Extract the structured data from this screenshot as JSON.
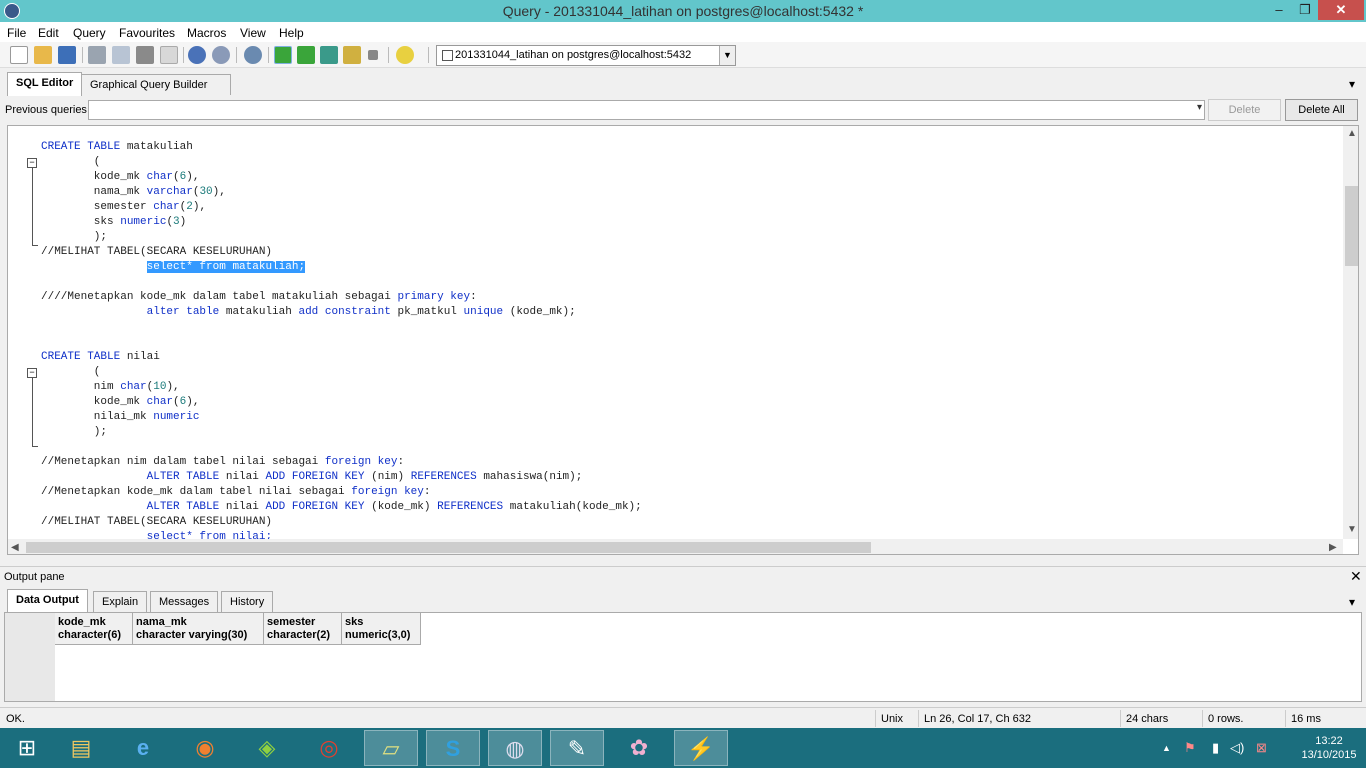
{
  "window": {
    "title": "Query - 201331044_latihan on postgres@localhost:5432 *",
    "min_glyph": "‒",
    "max_glyph": "❐",
    "close_glyph": "✕"
  },
  "menu": [
    "File",
    "Edit",
    "Query",
    "Favourites",
    "Macros",
    "View",
    "Help"
  ],
  "toolbar": {
    "icons": [
      "new-file-icon",
      "open-folder-icon",
      "save-icon",
      "cut-icon",
      "copy-icon",
      "paste-icon",
      "clear-icon",
      "undo-icon",
      "redo-icon",
      "find-icon",
      "execute-icon",
      "execute-pgscript-icon",
      "execute-to-file-icon",
      "explain-icon",
      "cancel-icon",
      "help-icon"
    ],
    "connection": "201331044_latihan on postgres@localhost:5432",
    "dropdown_glyph": "▼"
  },
  "editor_tabs": [
    "SQL Editor",
    "Graphical Query Builder"
  ],
  "panel_menu_glyph": "▾",
  "previous_queries": {
    "label": "Previous queries",
    "value": "",
    "delete": "Delete",
    "delete_all": "Delete All",
    "dropdown_glyph": "▾"
  },
  "scroll": {
    "up": "▲",
    "down": "▼",
    "left": "◀",
    "right": "▶"
  },
  "fold_glyph": "−",
  "code": {
    "l1a": "CREATE TABLE",
    "l1b": " matakuliah",
    "l2": "        (",
    "l3a": "        kode_mk ",
    "l3b": "char",
    "l3c": "(",
    "l3d": "6",
    "l3e": "),",
    "l4a": "        nama_mk ",
    "l4b": "varchar",
    "l4c": "(",
    "l4d": "30",
    "l4e": "),",
    "l5a": "        semester ",
    "l5b": "char",
    "l5c": "(",
    "l5d": "2",
    "l5e": "),",
    "l6a": "        sks ",
    "l6b": "numeric",
    "l6c": "(",
    "l6d": "3",
    "l6e": ")",
    "l7": "        );",
    "l8": "//MELIHAT TABEL(SECARA KESELURUHAN)",
    "l9a": "                ",
    "l9b": "select* from matakuliah;",
    "l10": "",
    "l11a": "////Menetapkan kode_mk dalam tabel matakuliah sebagai ",
    "l11b": "primary key",
    "l11c": ":",
    "l12a": "                ",
    "l12b": "alter table",
    "l12c": " matakuliah ",
    "l12d": "add constraint",
    "l12e": " pk_matkul ",
    "l12f": "unique",
    "l12g": " (kode_mk);",
    "l13": "",
    "l14": "",
    "l15a": "CREATE TABLE",
    "l15b": " nilai",
    "l16": "        (",
    "l17a": "        nim ",
    "l17b": "char",
    "l17c": "(",
    "l17d": "10",
    "l17e": "),",
    "l18a": "        kode_mk ",
    "l18b": "char",
    "l18c": "(",
    "l18d": "6",
    "l18e": "),",
    "l19a": "        nilai_mk ",
    "l19b": "numeric",
    "l20": "        );",
    "l21": "",
    "l22a": "//Menetapkan nim dalam tabel nilai sebagai ",
    "l22b": "foreign key",
    "l22c": ":",
    "l23a": "                ",
    "l23b": "ALTER TABLE",
    "l23c": " nilai ",
    "l23d": "ADD FOREIGN KEY",
    "l23e": " (nim) ",
    "l23f": "REFERENCES",
    "l23g": " mahasiswa(nim);",
    "l24a": "//Menetapkan kode_mk dalam tabel nilai sebagai ",
    "l24b": "foreign key",
    "l24c": ":",
    "l25a": "                ",
    "l25b": "ALTER TABLE",
    "l25c": " nilai ",
    "l25d": "ADD FOREIGN KEY",
    "l25e": " (kode_mk) ",
    "l25f": "REFERENCES",
    "l25g": " matakuliah(kode_mk);",
    "l26": "//MELIHAT TABEL(SECARA KESELURUHAN)",
    "l27a": "                ",
    "l27b": "select* from nilai;"
  },
  "output": {
    "label": "Output pane",
    "close_glyph": "✕",
    "tabs": [
      "Data Output",
      "Explain",
      "Messages",
      "History"
    ],
    "columns": [
      {
        "name": "kode_mk",
        "type": "character(6)"
      },
      {
        "name": "nama_mk",
        "type": "character varying(30)"
      },
      {
        "name": "semester",
        "type": "character(2)"
      },
      {
        "name": "sks",
        "type": "numeric(3,0)"
      }
    ]
  },
  "status": {
    "msg": "OK.",
    "eol": "Unix",
    "pos": "Ln 26, Col 17, Ch 632",
    "chars": "24 chars",
    "rows": "0 rows.",
    "time": "16 ms"
  },
  "taskbar": {
    "apps": [
      {
        "name": "start-button",
        "glyph": "⊞"
      },
      {
        "name": "file-explorer-icon",
        "glyph": "▤"
      },
      {
        "name": "internet-explorer-icon",
        "glyph": "e"
      },
      {
        "name": "firefox-icon",
        "glyph": "◉"
      },
      {
        "name": "bluestacks-icon",
        "glyph": "◈"
      },
      {
        "name": "chrome-icon",
        "glyph": "◎"
      },
      {
        "name": "sticky-notes-icon",
        "glyph": "▱"
      },
      {
        "name": "skype-icon",
        "glyph": "S"
      },
      {
        "name": "pgadmin-icon",
        "glyph": "◍"
      },
      {
        "name": "notepad-icon",
        "glyph": "✎"
      },
      {
        "name": "paint-icon",
        "glyph": "✿"
      },
      {
        "name": "winamp-icon",
        "glyph": "⚡"
      }
    ],
    "tray_glyphs": [
      "▲",
      "⚑",
      "▮",
      "◁)",
      "⊠"
    ],
    "time": "13:22",
    "date": "13/10/2015"
  },
  "colors": {
    "titlebar": "#62c6cb",
    "taskbar": "#1b6e7e",
    "keyword": "#1030c8",
    "number": "#1a7a7a",
    "selection": "#3399ff"
  }
}
